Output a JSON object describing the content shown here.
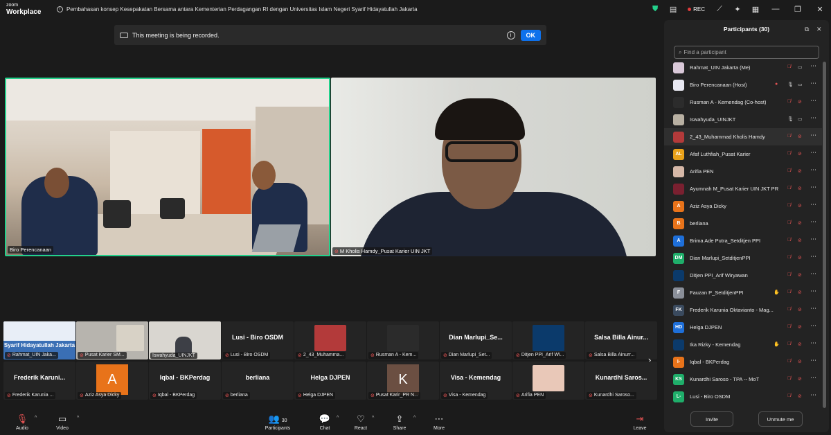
{
  "app": {
    "logo_line1": "zoom",
    "logo_line2": "Workplace"
  },
  "meeting": {
    "title": "Pembahasan konsep Kesepakatan Bersama antara Kementerian Perdagangan RI dengan Universitas Islam Negeri Syarif Hidayatullah Jakarta"
  },
  "titlebar": {
    "rec_label": "REC",
    "accent_color": "#23d18b",
    "rec_color": "#e23b3b"
  },
  "banner": {
    "text": "This meeting is being recorded.",
    "ok_label": "OK"
  },
  "videos": [
    {
      "label": "Biro Perencanaan"
    },
    {
      "label": "M Kholis Hamdy_Pusat Karier UIN JKT"
    }
  ],
  "strip": {
    "row1": [
      {
        "name": "",
        "label": "Rahmat_UIN Jaka...",
        "overlay": "Syarif Hidayatullah Jakarta"
      },
      {
        "name": "",
        "label": "Pusat Karier SM..."
      },
      {
        "name": "",
        "label": "Iswahyuda_UINJKT"
      },
      {
        "name": "Lusi - Biro OSDM",
        "label": "Lusi - Biro OSDM"
      },
      {
        "name": "",
        "label": "2_43_Muhamma..."
      },
      {
        "name": "",
        "label": "Rusman A - Kem..."
      },
      {
        "name": "Dian Marlupi_Se...",
        "label": "Dian Marlupi_Set..."
      },
      {
        "name": "",
        "label": "Ditjen PPI_Arif Wi..."
      },
      {
        "name": "Salsa Billa Ainur...",
        "label": "Salsa Billa Ainurr..."
      }
    ],
    "row2": [
      {
        "name": "Frederik Karuni...",
        "label": "Frederik Karunia ..."
      },
      {
        "name": "",
        "label": "Aziz Asya Dicky",
        "avatar_letter": "A",
        "avatar_color": "#e8731a"
      },
      {
        "name": "Iqbal - BKPerdag",
        "label": "Iqbal - BKPerdag"
      },
      {
        "name": "berliana",
        "label": "berliana"
      },
      {
        "name": "Helga DJPEN",
        "label": "Helga DJPEN"
      },
      {
        "name": "",
        "label": "Pusat Karir_PR N...",
        "avatar_letter": "K",
        "avatar_color": "#6b4f42"
      },
      {
        "name": "Visa - Kemendag",
        "label": "Visa - Kemendag"
      },
      {
        "name": "",
        "label": "Arifia PEN"
      },
      {
        "name": "Kunardhi Saros...",
        "label": "Kunardhi Saroso..."
      }
    ],
    "next_icon": "chevron-right-icon"
  },
  "toolbar": {
    "audio": "Audio",
    "video": "Video",
    "participants": "Participants",
    "participants_count": "30",
    "chat": "Chat",
    "react": "React",
    "share": "Share",
    "more": "More",
    "leave": "Leave"
  },
  "panel": {
    "title": "Participants (30)",
    "search_placeholder": "Find a participant",
    "invite": "Invite",
    "unmute_me": "Unmute me",
    "participants": [
      {
        "name": "Rahmat_UIN Jakarta (Me)",
        "avatar": "",
        "color": "#d9c8d8",
        "mic": "off",
        "cam": "on"
      },
      {
        "name": "Biro Perencanaan (Host)",
        "avatar": "",
        "color": "#e9e9f2",
        "mic": "dot",
        "cam": "on",
        "extra": "mic-on"
      },
      {
        "name": "Rusman A - Kemendag (Co-host)",
        "avatar": "",
        "color": "#2c2c2c",
        "mic": "off",
        "cam": "off"
      },
      {
        "name": "Iswahyuda_UINJKT",
        "avatar": "",
        "color": "#b8b0a2",
        "mic": "on",
        "cam": "on"
      },
      {
        "name": "2_43_Muhammad Kholis Hamdy",
        "avatar": "",
        "color": "#b33a3a",
        "mic": "off",
        "cam": "off",
        "highlight": true
      },
      {
        "name": "Afaf Luthfiah_Pusat Karier",
        "avatar": "AL",
        "color": "#e8a11a",
        "mic": "off",
        "cam": "off"
      },
      {
        "name": "Arifia PEN",
        "avatar": "",
        "color": "#d6b8a8",
        "mic": "off",
        "cam": "off"
      },
      {
        "name": "Ayumnah M_Pusat Karier UIN JKT PR",
        "avatar": "",
        "color": "#7a2030",
        "mic": "off",
        "cam": "off"
      },
      {
        "name": "Aziz Asya Dicky",
        "avatar": "A",
        "color": "#e8731a",
        "mic": "off",
        "cam": "off"
      },
      {
        "name": "berliana",
        "avatar": "B",
        "color": "#e8731a",
        "mic": "off",
        "cam": "off"
      },
      {
        "name": "Brima Ade Putra_Setditjen PPI",
        "avatar": "A",
        "color": "#1e6fd9",
        "mic": "off",
        "cam": "off"
      },
      {
        "name": "Dian Marlupi_SetditjenPPI",
        "avatar": "DM",
        "color": "#1fae6a",
        "mic": "off",
        "cam": "off"
      },
      {
        "name": "Ditjen PPI_Arif Wiryawan",
        "avatar": "",
        "color": "#0b3a6b",
        "mic": "off",
        "cam": "off"
      },
      {
        "name": "Fauzan P_SetditjenPPI",
        "avatar": "F",
        "color": "#8a8f99",
        "mic": "off",
        "cam": "off",
        "extra": "hand"
      },
      {
        "name": "Frederik Karunia Oktavianto - Mag...",
        "avatar": "FK",
        "color": "#3a4a5e",
        "mic": "off",
        "cam": "off"
      },
      {
        "name": "Helga DJPEN",
        "avatar": "HD",
        "color": "#1e6fd9",
        "mic": "off",
        "cam": "off"
      },
      {
        "name": "Ika Rizky - Kemendag",
        "avatar": "",
        "color": "#0b3a6b",
        "mic": "off",
        "cam": "off",
        "extra": "hand"
      },
      {
        "name": "Iqbal - BKPerdag",
        "avatar": "I-",
        "color": "#e8731a",
        "mic": "off",
        "cam": "off"
      },
      {
        "name": "Kunardhi Saroso - TPA -- MoT",
        "avatar": "KS",
        "color": "#1fae6a",
        "mic": "off",
        "cam": "off"
      },
      {
        "name": "Lusi - Biro OSDM",
        "avatar": "L-",
        "color": "#1fae6a",
        "mic": "off",
        "cam": "off"
      }
    ]
  }
}
